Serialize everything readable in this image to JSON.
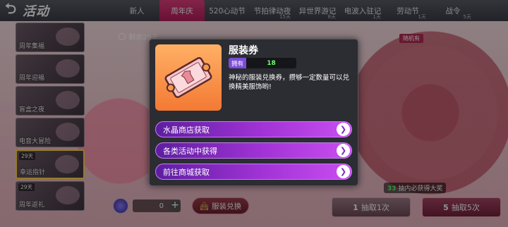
{
  "header": {
    "title": "活动",
    "tabs": [
      {
        "label": "新人",
        "days": ""
      },
      {
        "label": "周年庆",
        "days": ""
      },
      {
        "label": "520心动节",
        "days": ""
      },
      {
        "label": "节拍律动夜",
        "days": "15天"
      },
      {
        "label": "异世界游记",
        "days": "8天"
      },
      {
        "label": "电波入驻记",
        "days": "1天"
      },
      {
        "label": "劳动节",
        "days": "1天"
      },
      {
        "label": "战令",
        "days": "5天"
      }
    ],
    "active_tab_index": 1
  },
  "sidebar": {
    "items": [
      {
        "label": "周年集福",
        "tag": ""
      },
      {
        "label": "周年迎福",
        "tag": ""
      },
      {
        "label": "盲盒之夜",
        "tag": ""
      },
      {
        "label": "电音大冒险",
        "tag": ""
      },
      {
        "label": "幸运指针",
        "tag": "29天",
        "selected": true
      },
      {
        "label": "周年返礼",
        "tag": "29天"
      }
    ]
  },
  "remaining": "剩余29天",
  "bottom": {
    "quantity": "0",
    "exchange_label": "服装兑换"
  },
  "wheel": {
    "top_label": "随机有",
    "guarantee_count": "33",
    "guarantee_text": "抽内必获得大奖"
  },
  "draw": {
    "one_cost": "1",
    "one_label": "抽取1次",
    "five_cost": "5",
    "five_label": "抽取5次"
  },
  "popup": {
    "item_name": "服装券",
    "own_label": "拥有",
    "own_count": "18",
    "description": "神秘的服装兑换券，攒够一定数量可以兑换精美服饰哟!",
    "sources": [
      {
        "label": "水晶商店获取"
      },
      {
        "label": "各类活动中获得"
      },
      {
        "label": "前往商城获取"
      }
    ]
  },
  "colors": {
    "active_tab": "#c8286a",
    "source_button": "#a233d6",
    "own_count": "#6dff6d",
    "item_card": "#f59a4a"
  }
}
